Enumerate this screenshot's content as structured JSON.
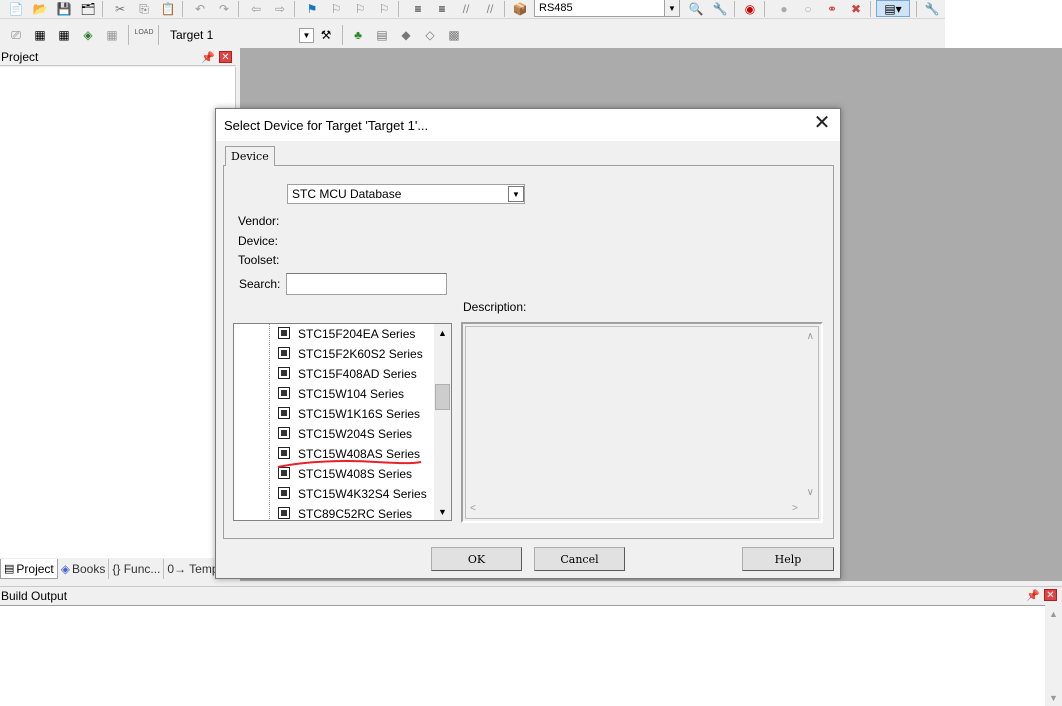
{
  "toolbar": {
    "target_combo": "RS485",
    "target_select": "Target 1"
  },
  "project_panel": {
    "title": "Project",
    "tabs": [
      "Project",
      "Books",
      "{} Func...",
      "0→ Temp..."
    ]
  },
  "build_output": {
    "title": "Build Output"
  },
  "dialog": {
    "title": "Select Device for Target 'Target 1'...",
    "tab": "Device",
    "database": "STC MCU Database",
    "vendor_label": "Vendor:",
    "device_label": "Device:",
    "toolset_label": "Toolset:",
    "search_label": "Search:",
    "search_value": "",
    "description_label": "Description:",
    "device_list": [
      "STC15F204EA Series",
      "STC15F2K60S2 Series",
      "STC15F408AD Series",
      "STC15W104 Series",
      "STC15W1K16S Series",
      "STC15W204S Series",
      "STC15W408AS Series",
      "STC15W408S Series",
      "STC15W4K32S4 Series",
      "STC89C52RC Series"
    ],
    "ok_label": "OK",
    "cancel_label": "Cancel",
    "help_label": "Help"
  },
  "colors": {
    "workspace": "#ababab",
    "annotation": "#e8202a"
  }
}
